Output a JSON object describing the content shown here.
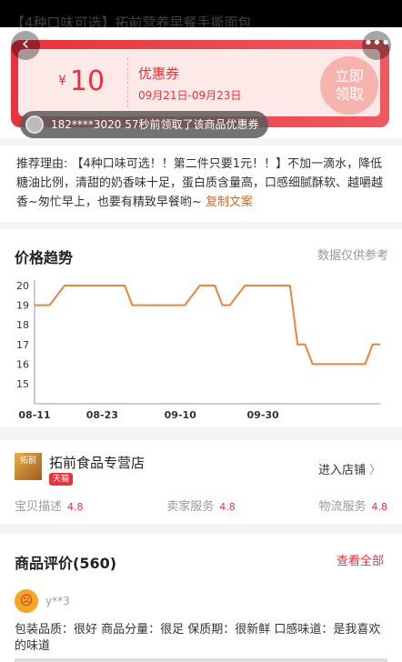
{
  "header": {
    "title": "【4种口味可选】拓前营养早餐手撕面包",
    "back_icon": "‹",
    "more_icon": "•••"
  },
  "coupon": {
    "currency": "¥",
    "amount": "10",
    "title": "优惠券",
    "date_range": "09月21日-09月23日",
    "claim_label_1": "立即",
    "claim_label_2": "领取",
    "notice": "182****3020 57秒前领取了该商品优惠券"
  },
  "recommendation": {
    "label": "推荐理由:",
    "text": "【4种口味可选！！第二件只要1元！！】不加一滴水，降低糖油比例，清甜的奶香味十足，蛋白质含量高，口感细腻酥软、越嚼越香~匆忙早上，也要有精致早餐哟~",
    "copy_link": "复制文案"
  },
  "trend": {
    "title": "价格趋势",
    "note": "数据仅供参考"
  },
  "chart_data": {
    "type": "line",
    "x_ticks": [
      "08-11",
      "08-23",
      "09-10",
      "09-30"
    ],
    "y_ticks": [
      20,
      19,
      18,
      17,
      16,
      15
    ],
    "ylim": [
      15,
      20
    ],
    "line_color": "#e8853c",
    "series": [
      {
        "values": [
          19,
          19,
          20,
          20,
          20,
          19,
          19,
          19,
          19,
          20,
          20,
          19,
          19,
          20,
          20,
          20,
          17,
          17,
          16,
          16,
          16,
          16,
          17,
          17
        ],
        "x_index": [
          0,
          1,
          2,
          4,
          6,
          6.5,
          7,
          9,
          10,
          11,
          12,
          12.5,
          13,
          14,
          16,
          17,
          17.5,
          18,
          18.5,
          20,
          21,
          22,
          22.5,
          23
        ]
      }
    ]
  },
  "store": {
    "logo_text": "拓前",
    "name": "拓前食品专营店",
    "badge": "天猫",
    "enter_label": "进入店铺",
    "scores": [
      {
        "label": "宝贝描述",
        "value": "4.8"
      },
      {
        "label": "卖家服务",
        "value": "4.8"
      },
      {
        "label": "物流服务",
        "value": "4.8"
      }
    ]
  },
  "reviews": {
    "title": "商品评价(560)",
    "view_all": "查看全部",
    "user": "y**3",
    "text": "包装品质：很好 商品分量：很足 保质期：很新鲜 口感味道：是我喜欢的味道"
  }
}
